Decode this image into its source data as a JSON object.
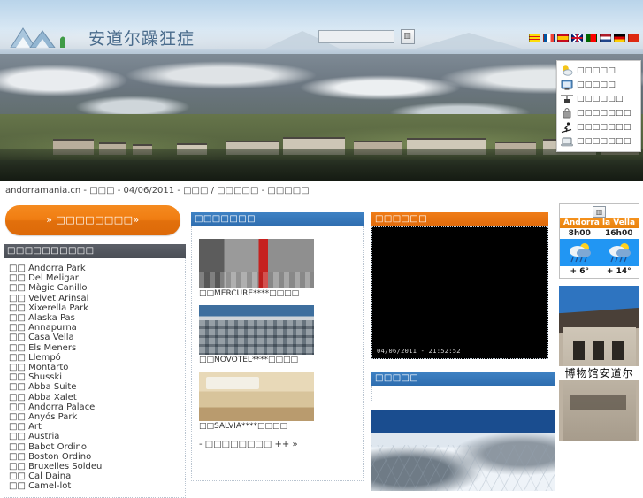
{
  "header": {
    "site_title": "安道尔躁狂症",
    "logo_icon": "mountain-logo-icon",
    "search": {
      "value": "",
      "placeholder": "",
      "button_icon": "search-icon"
    },
    "languages": [
      {
        "code": "ca",
        "name": "catalan-flag-icon"
      },
      {
        "code": "fr",
        "name": "french-flag-icon"
      },
      {
        "code": "es",
        "name": "spanish-flag-icon"
      },
      {
        "code": "en",
        "name": "uk-flag-icon"
      },
      {
        "code": "pt",
        "name": "portuguese-flag-icon"
      },
      {
        "code": "nl",
        "name": "dutch-flag-icon"
      },
      {
        "code": "de",
        "name": "german-flag-icon"
      },
      {
        "code": "zh",
        "name": "chinese-flag-icon"
      }
    ]
  },
  "topmenu": {
    "items": [
      {
        "icon": "weather-sun-cloud-icon",
        "label": "□□□□□"
      },
      {
        "icon": "webcam-monitor-icon",
        "label": "□□□□□"
      },
      {
        "icon": "chairlift-icon",
        "label": "□□□□□□"
      },
      {
        "icon": "shopping-bag-icon",
        "label": "□□□□□□□"
      },
      {
        "icon": "skier-icon",
        "label": "□□□□□□□"
      },
      {
        "icon": "laptop-icon",
        "label": "□□□□□□□"
      }
    ]
  },
  "breadcrumb": "andorramania.cn - □□□ - 04/06/2011 - □□□ / □□□□□ - □□□□□",
  "promo": {
    "label": "» □□□□□□□□»"
  },
  "left_panel": {
    "title": "□□□□□□□□□□",
    "hotels": [
      "□□ Andorra Park",
      "□□ Del Meligar",
      "□□ Màgic Canillo",
      "□□ Velvet Arinsal",
      "□□ Xixerella Park",
      "□□ Alaska Pas",
      "□□ Annapurna",
      "□□ Casa Vella",
      "□□ Els Meners",
      "□□ Llempó",
      "□□ Montarto",
      "□□ Shusski",
      "□□ Abba Suite",
      "□□ Abba Xalet",
      "□□ Andorra Palace",
      "□□ Anyós Park",
      "□□ Art",
      "□□ Austria",
      "□□ Babot Ordino",
      "□□ Boston Ordino",
      "□□ Bruxelles Soldeu",
      "□□ Cal Daina",
      "□□ Camel-lot"
    ]
  },
  "mid_panel": {
    "title": "□□□□□□□",
    "items": [
      {
        "image": "hotel-mercure-photo",
        "caption": "□□MERCURE****□□□□"
      },
      {
        "image": "hotel-novotel-photo",
        "caption": "□□NOVOTEL****□□□□"
      },
      {
        "image": "hotel-salvia-photo",
        "caption": "□□SALVIA****□□□□"
      }
    ],
    "more_link": "- □□□□□□□□ ++ »"
  },
  "cam_panel": {
    "title": "□□□□□□",
    "image": "webcam-night-view",
    "timestamp": "04/06/2011 - 21:52:52"
  },
  "ski_panel": {
    "title": "□□□□□",
    "image": "ski-slope-photo"
  },
  "weather": {
    "expand_icon": "expand-icon",
    "city": "Andorra la Vella",
    "forecasts": [
      {
        "hour": "8h00",
        "icon": "sun-cloud-rain-icon",
        "temp": "+ 6°"
      },
      {
        "hour": "16h00",
        "icon": "sun-cloud-rain-icon",
        "temp": "+ 14°"
      }
    ]
  },
  "museum": {
    "image": "museum-building-photo",
    "caption": "博物馆安道尔"
  },
  "colors": {
    "orange": "#f07d12",
    "blue": "#2e6daf",
    "dark_gray": "#4a4e55",
    "weather_blue": "#2196f3"
  }
}
